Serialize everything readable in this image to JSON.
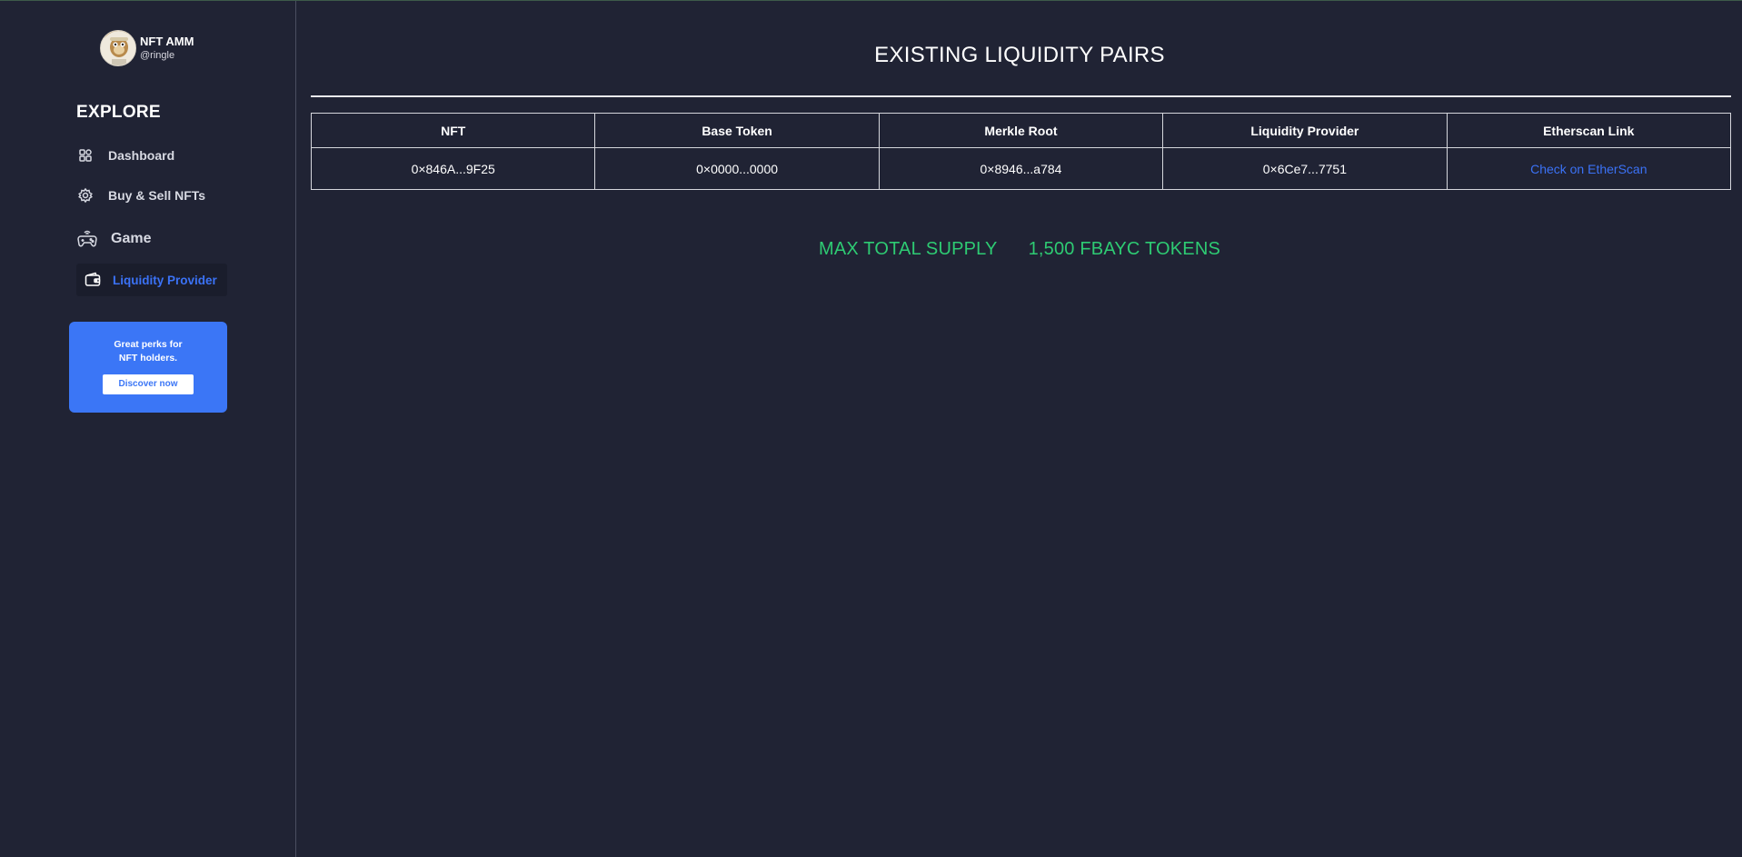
{
  "profile": {
    "name": "NFT AMM",
    "handle": "@ringle",
    "avatar_icon": "ape-avatar"
  },
  "sidebar": {
    "section_title": "EXPLORE",
    "items": [
      {
        "label": "Dashboard",
        "icon": "dashboard-icon",
        "active": false
      },
      {
        "label": "Buy & Sell NFTs",
        "icon": "gear-icon",
        "active": false
      },
      {
        "label": "Game",
        "icon": "gamepad-icon",
        "active": false
      },
      {
        "label": "Liquidity Provider",
        "icon": "wallet-icon",
        "active": true
      }
    ],
    "promo": {
      "line1": "Great perks for",
      "line2": "NFT holders.",
      "button": "Discover now"
    }
  },
  "main": {
    "title": "EXISTING LIQUIDITY PAIRS",
    "table": {
      "headers": [
        "NFT",
        "Base Token",
        "Merkle Root",
        "Liquidity Provider",
        "Etherscan Link"
      ],
      "rows": [
        [
          "0×846A...9F25",
          "0×0000...0000",
          "0×8946...a784",
          "0×6Ce7...7751",
          "Check on EtherScan"
        ]
      ]
    },
    "supply_label": "MAX TOTAL SUPPLY",
    "supply_value": "1,500 FBAYC TOKENS"
  },
  "colors": {
    "background": "#202334",
    "accent_blue": "#3b76f6",
    "supply_green": "#2ecb73",
    "active_item_bg": "#1a1d2c"
  }
}
